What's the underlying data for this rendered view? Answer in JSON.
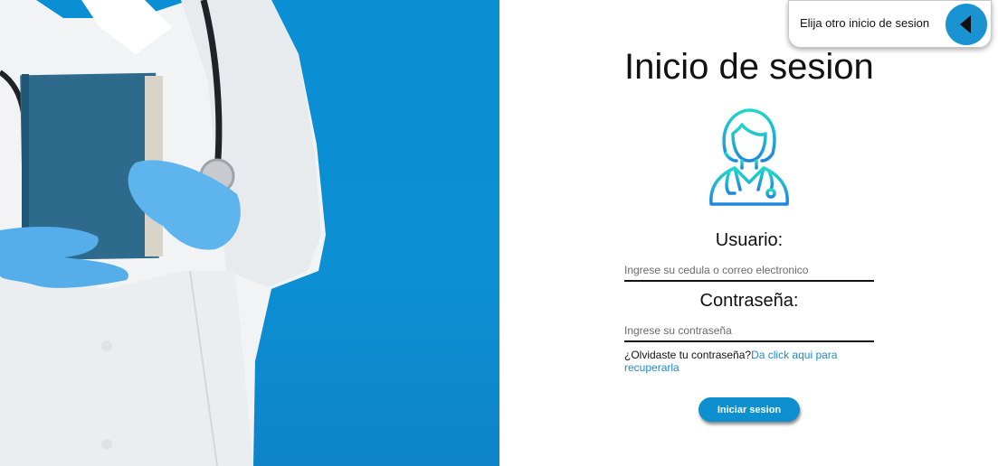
{
  "switcher": {
    "label": "Elija otro inicio de sesion",
    "icon": "triangle-left-icon"
  },
  "form": {
    "title": "Inicio de sesion",
    "avatar_icon": "doctor-female-icon",
    "user_label": "Usuario:",
    "user_placeholder": "Ingrese su cedula o correo electronico",
    "password_label": "Contraseña:",
    "password_placeholder": "Ingrese su contraseña",
    "forgot_text": "¿Olvidaste tu contraseña?",
    "forgot_link": "Da click aqui para recuperarla",
    "submit_label": "Iniciar sesion"
  },
  "colors": {
    "accent": "#0e8fcf",
    "hero_bg": "#0c8fd3",
    "link": "#1a8ccd"
  }
}
